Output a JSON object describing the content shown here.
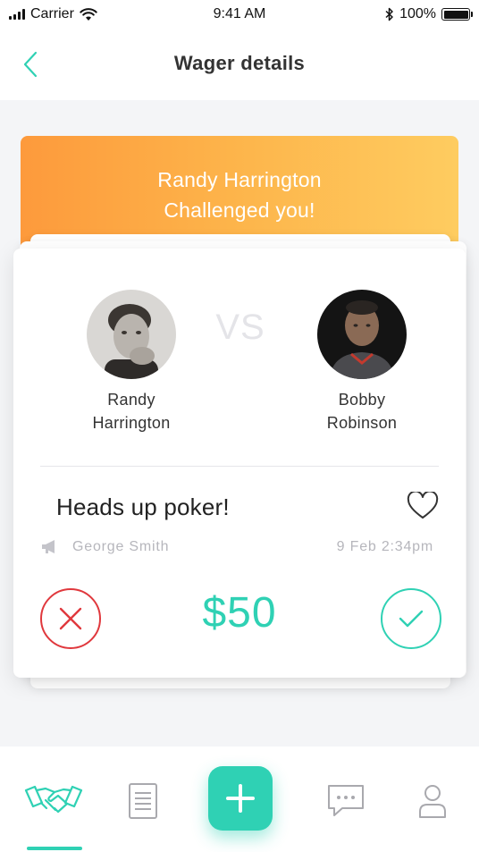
{
  "status_bar": {
    "carrier": "Carrier",
    "time": "9:41 AM",
    "battery": "100%",
    "icons": [
      "signal-icon",
      "wifi-icon",
      "bluetooth-icon",
      "battery-icon"
    ]
  },
  "nav": {
    "title": "Wager details",
    "back_icon": "chevron-left-icon"
  },
  "challenge": {
    "header_line1": "Randy Harrington",
    "header_line2": "Challenged you!",
    "header_gradient": [
      "#fd9a3c",
      "#fecc60"
    ]
  },
  "players": {
    "left": {
      "first": "Randy",
      "last": "Harrington"
    },
    "right": {
      "first": "Bobby",
      "last": "Robinson"
    },
    "vs_label": "VS"
  },
  "wager": {
    "title": "Heads up poker!",
    "host": "George Smith",
    "date": "9 Feb 2:34pm",
    "amount": "$50",
    "icons": [
      "heart-icon",
      "megaphone-icon",
      "reject-x-icon",
      "accept-check-icon"
    ]
  },
  "tab_bar": {
    "tabs": [
      {
        "icon": "handshake-icon",
        "active": true
      },
      {
        "icon": "document-icon",
        "active": false
      },
      {
        "icon": "plus-icon",
        "active": false
      },
      {
        "icon": "chat-icon",
        "active": false
      },
      {
        "icon": "user-icon",
        "active": false
      }
    ]
  },
  "colors": {
    "accent": "#2fd1b4",
    "reject": "#e0383d",
    "muted": "#b6b6bc"
  }
}
